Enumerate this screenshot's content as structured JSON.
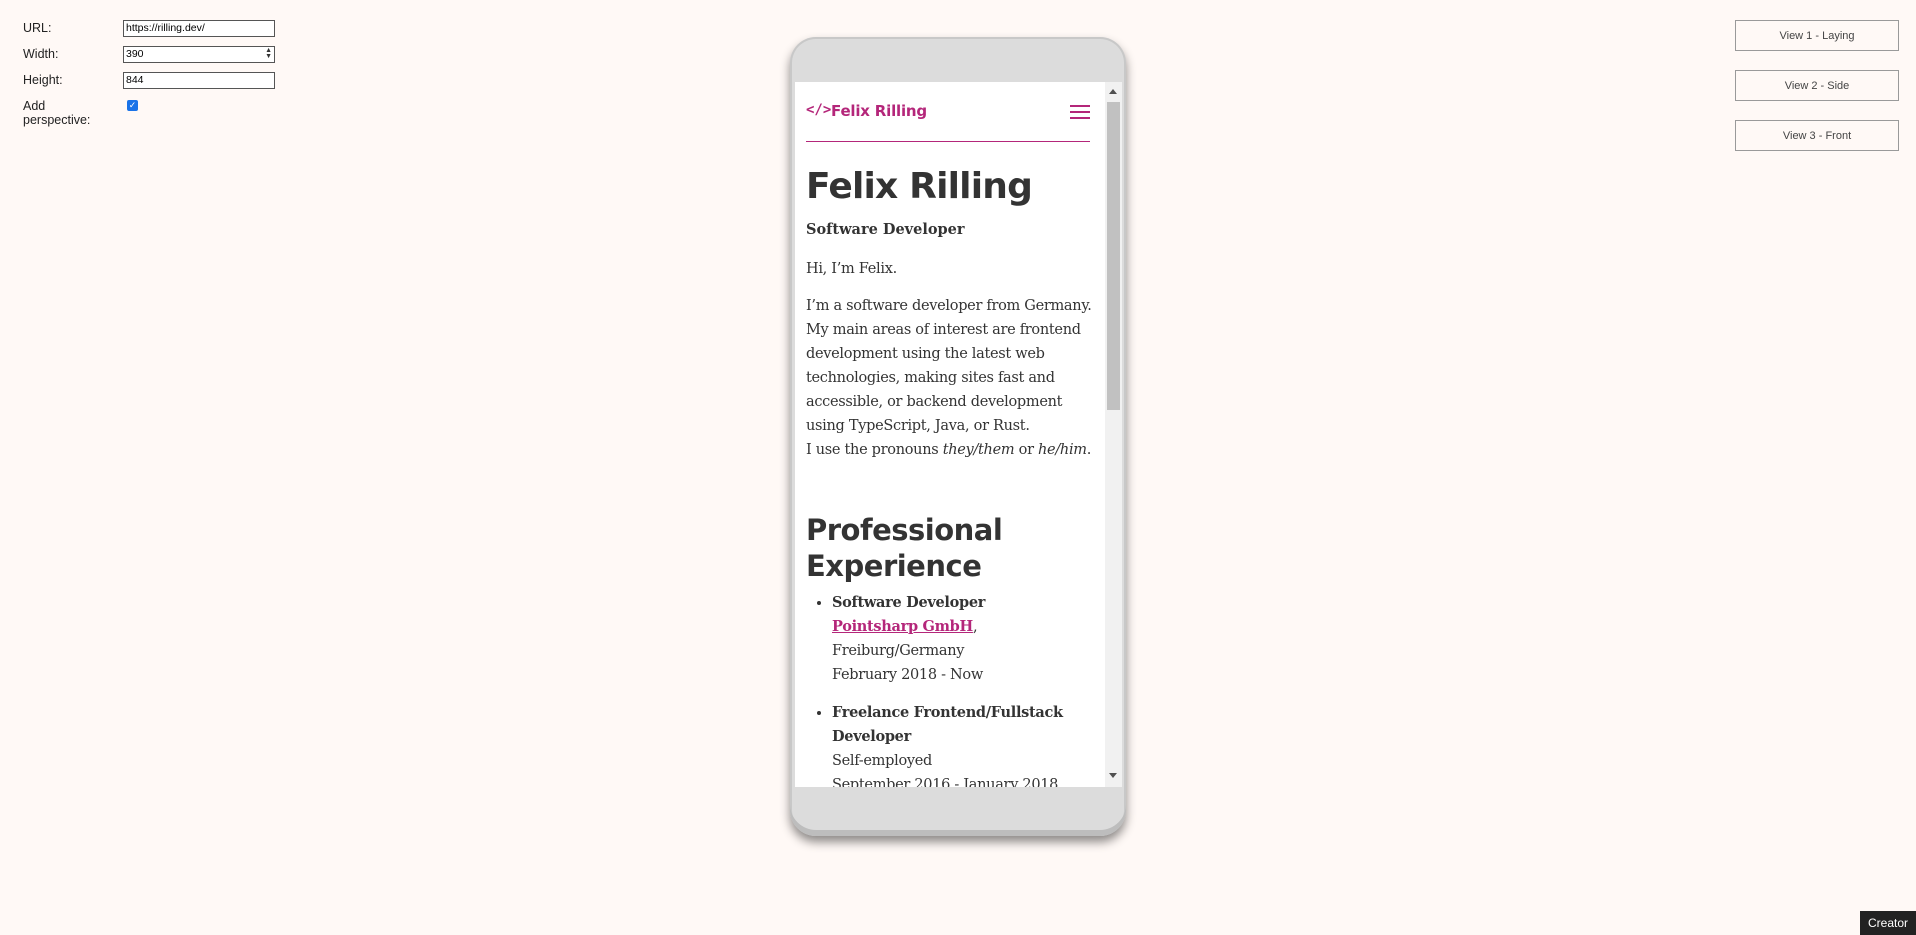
{
  "controls": {
    "url_label": "URL:",
    "url_value": "https://rilling.dev/",
    "width_label": "Width:",
    "width_value": "390",
    "height_label": "Height:",
    "height_value": "844",
    "perspective_label": "Add perspective:",
    "perspective_checked": true
  },
  "view_buttons": [
    "View 1 - Laying",
    "View 2 - Side",
    "View 3 - Front"
  ],
  "site": {
    "logo_icon": "</>",
    "logo_text": "Felix Rilling",
    "hero_title": "Felix Rilling",
    "subtitle": "Software Developer",
    "greeting": "Hi, I’m Felix.",
    "intro_line1": "I’m a software developer from Germany.",
    "intro_line2": "My main areas of interest are frontend development using the latest web technologies, making sites fast and accessible, or backend development using TypeScript, Java, or Rust.",
    "pronoun_prefix": "I use the pronouns ",
    "pronoun_1": "they/them",
    "pronoun_or": " or ",
    "pronoun_2": "he/him",
    "pronoun_suffix": ".",
    "section_title": "Professional Experience",
    "experience": [
      {
        "role": "Software Developer",
        "company": "Pointsharp GmbH",
        "after_company": ",",
        "location": "Freiburg/Germany",
        "dates": "February 2018 - Now"
      },
      {
        "role": "Freelance Frontend/Fullstack Developer",
        "company": "Self-employed",
        "dates": "September 2016 - January 2018"
      }
    ]
  },
  "footer": {
    "creator_label": "Creator"
  },
  "colors": {
    "accent": "#b4267a",
    "background": "#fff9f6",
    "text": "#333333"
  }
}
